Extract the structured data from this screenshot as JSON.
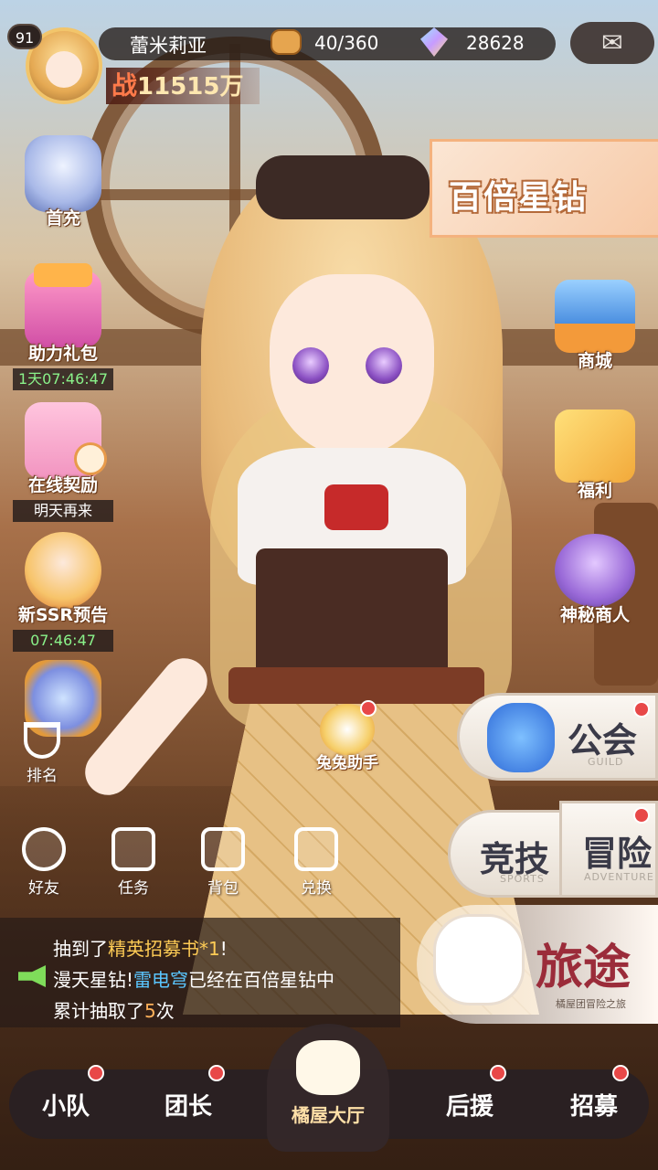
{
  "player": {
    "level": "91",
    "name": "蕾米莉亚",
    "stamina": "40/360",
    "gems": "28628",
    "power_tag": "战",
    "power_value": "11515万"
  },
  "left_menu": [
    {
      "label": "首充",
      "timer": ""
    },
    {
      "label": "助力礼包",
      "timer": "1天07:46:47"
    },
    {
      "label": "在线契励",
      "timer": "明天再来"
    },
    {
      "label": "新SSR预告",
      "timer": "07:46:47"
    }
  ],
  "rank": {
    "label": "排名"
  },
  "functions": [
    {
      "label": "好友"
    },
    {
      "label": "任务"
    },
    {
      "label": "背包"
    },
    {
      "label": "兑换"
    }
  ],
  "helper": {
    "label": "兔兔助手"
  },
  "banner": {
    "text": "百倍星钻"
  },
  "right_menu": [
    {
      "label": "商城"
    },
    {
      "label": "福利"
    },
    {
      "label": "神秘商人"
    }
  ],
  "modes": {
    "guild": {
      "label": "公会",
      "sub": "GUILD"
    },
    "arena": {
      "label": "竞技",
      "sub": "SPORTS"
    },
    "adventure": {
      "label": "冒险",
      "sub": "ADVENTURE"
    }
  },
  "journey": {
    "title": "旅途",
    "subtitle": "橘屋团冒险之旅"
  },
  "chat": {
    "line1_prefix": "抽到了",
    "line1_item": "精英招募书*1",
    "line1_suffix": "!",
    "line2_prefix": "漫天星钻!",
    "line2_player": "雷电穹",
    "line2_suffix": "已经在百倍星钻中",
    "line3_prefix": "累计抽取了",
    "line3_count": "5",
    "line3_suffix": "次"
  },
  "bottom_nav": {
    "squad": "小队",
    "leader": "团长",
    "hall": "橘屋大厅",
    "support": "后援",
    "recruit": "招募"
  },
  "icons": {
    "mail": "mail-icon",
    "stamina": "bread-icon",
    "gems": "gem-icon",
    "horn": "horn-icon"
  },
  "colors": {
    "notification_dot": "#e84848",
    "chat_highlight_yellow": "#ffcc55",
    "chat_highlight_blue": "#5ac6ff",
    "timer_green": "#8af28a"
  }
}
